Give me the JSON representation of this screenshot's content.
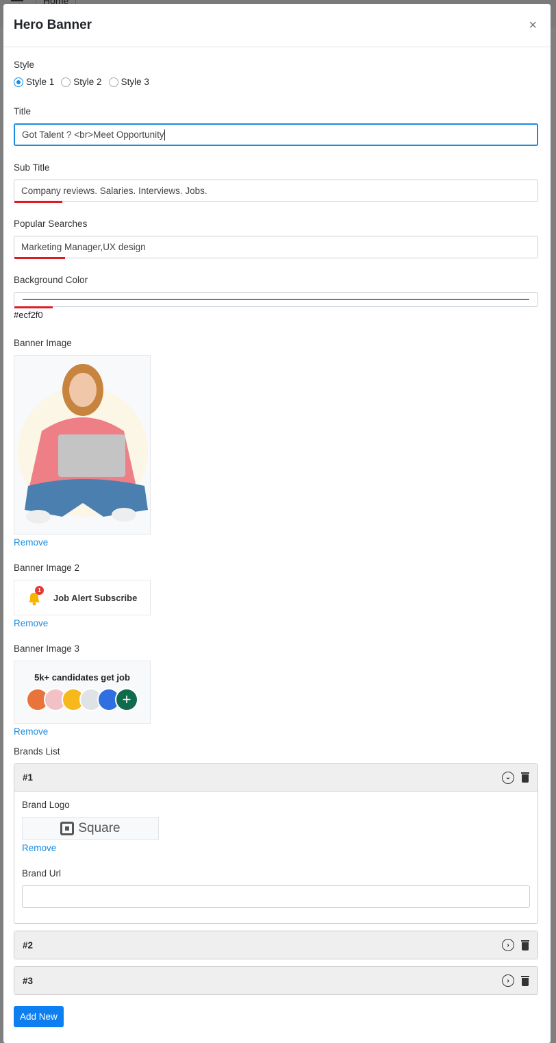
{
  "background": {
    "nav_tab": "Home"
  },
  "modal": {
    "title": "Hero Banner",
    "close_icon": "×"
  },
  "style": {
    "label": "Style",
    "options": [
      "Style 1",
      "Style 2",
      "Style 3"
    ],
    "selected": "Style 1"
  },
  "title": {
    "label": "Title",
    "value": "Got Talent ? <br>Meet Opportunity"
  },
  "subtitle": {
    "label": "Sub Title",
    "value": "Company reviews. Salaries. Interviews. Jobs."
  },
  "popular": {
    "label": "Popular Searches",
    "value": "Marketing Manager,UX design"
  },
  "bgcolor": {
    "label": "Background Color",
    "value": "#ecf2f0"
  },
  "banner1": {
    "label": "Banner Image",
    "remove": "Remove"
  },
  "banner2": {
    "label": "Banner Image 2",
    "text": "Job Alert Subscribe",
    "badge": "1",
    "remove": "Remove"
  },
  "banner3": {
    "label": "Banner Image 3",
    "text": "5k+ candidates get job",
    "remove": "Remove"
  },
  "brands": {
    "label": "Brands List",
    "items": [
      {
        "title": "#1",
        "logo_label": "Brand Logo",
        "logo_text": "Square",
        "remove": "Remove",
        "url_label": "Brand Url",
        "url_value": ""
      },
      {
        "title": "#2"
      },
      {
        "title": "#3"
      }
    ]
  },
  "add_new": "Add New"
}
